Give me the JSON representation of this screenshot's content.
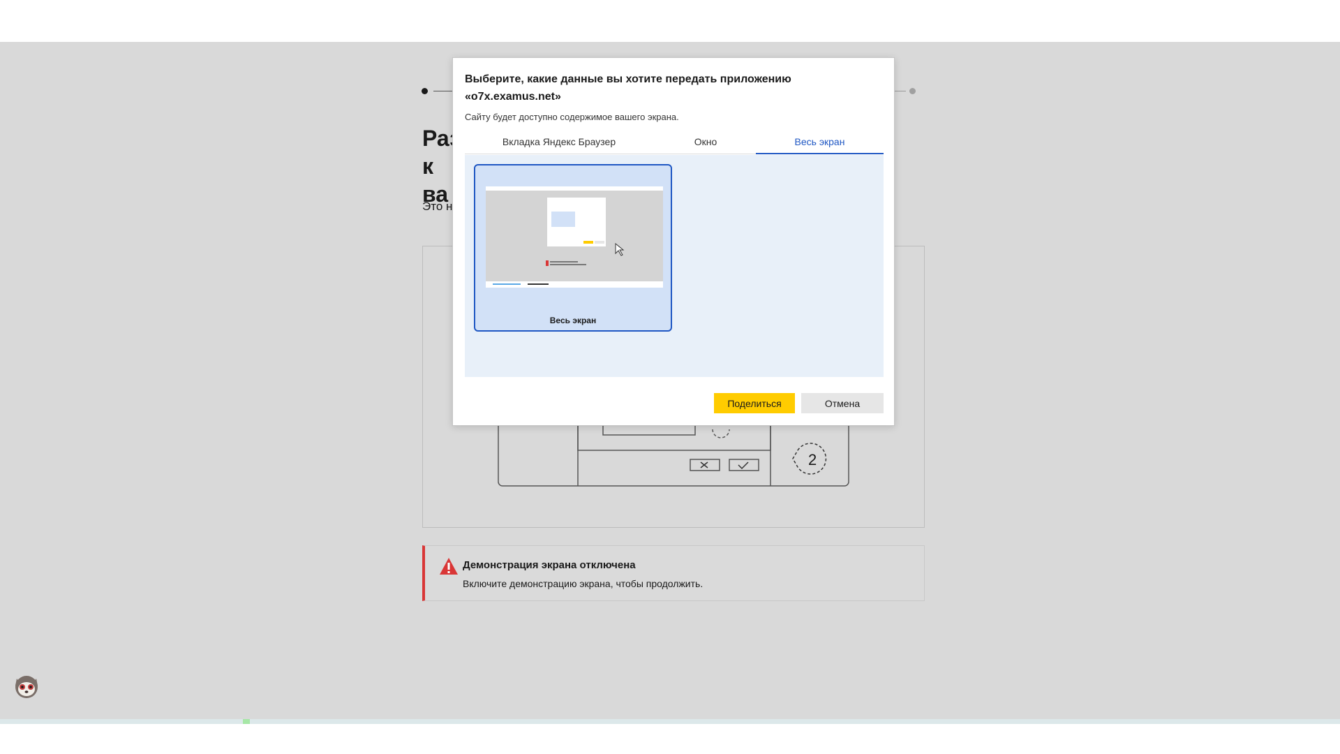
{
  "background_page": {
    "heading_line1": "Раз",
    "heading_line2": "к ва",
    "text_fragment": "Это н",
    "alert": {
      "title": "Демонстрация экрана отключена",
      "description": "Включите демонстрацию экрана, чтобы продолжить."
    },
    "illustration": {
      "step_number": "2"
    }
  },
  "dialog": {
    "title": "Выберите, какие данные вы хотите передать приложению «o7x.examus.net»",
    "subtitle": "Сайту будет доступно содержимое вашего экрана.",
    "tabs": [
      {
        "label": "Вкладка Яндекс Браузер",
        "selected": false
      },
      {
        "label": "Окно",
        "selected": false
      },
      {
        "label": "Весь экран",
        "selected": true
      }
    ],
    "sources": [
      {
        "label": "Весь экран",
        "selected": true
      }
    ],
    "buttons": {
      "share": "Поделиться",
      "cancel": "Отмена"
    }
  },
  "colors": {
    "accent": "#1f57c3",
    "share_button": "#ffcc00",
    "alert_red": "#d93636",
    "overlay_gray": "#d9d9d9"
  }
}
